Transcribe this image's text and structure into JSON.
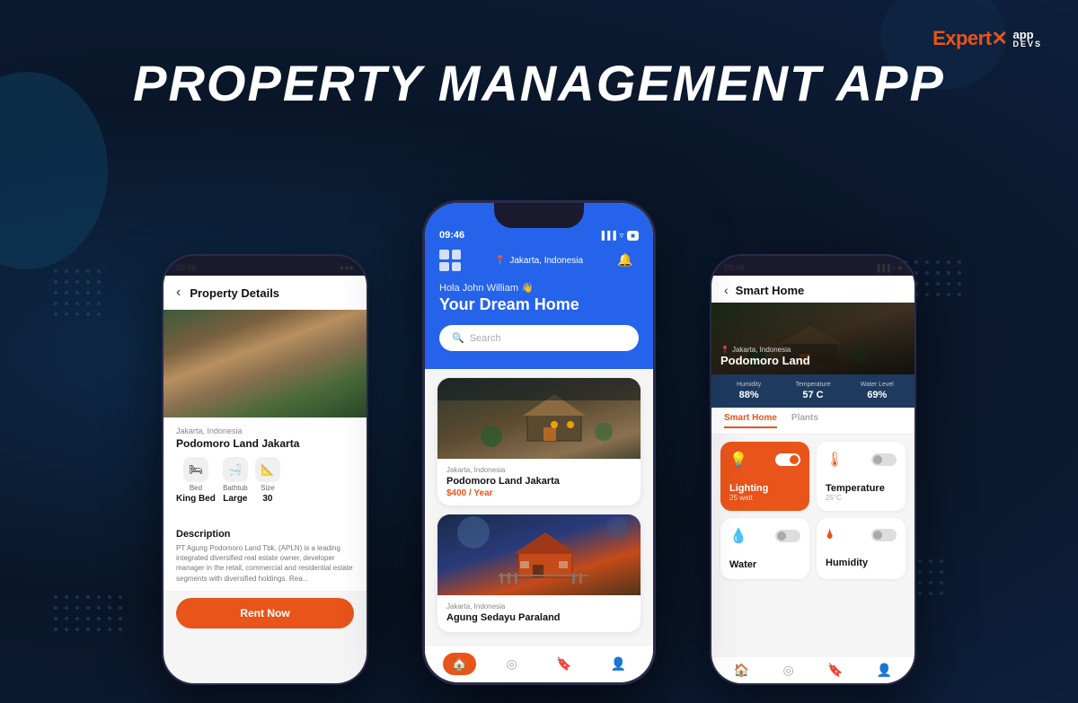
{
  "app": {
    "title": "PROPERTY MANAGEMENT APP",
    "logo": {
      "expert": "Expert",
      "app": "app",
      "devs": "DEVS"
    }
  },
  "left_phone": {
    "status_time": "09:46",
    "header_title": "Property Details",
    "back": "‹",
    "location": "Jakarta, Indonesia",
    "property_name": "Podomoro Land Jakarta",
    "amenities": [
      {
        "icon": "🛏",
        "label": "Bed",
        "value": "King Bed"
      },
      {
        "icon": "🛁",
        "label": "Bathtub",
        "value": "Large"
      },
      {
        "icon": "📐",
        "label": "Size",
        "value": "30"
      }
    ],
    "description_title": "Description",
    "description_text": "PT Agung Podomoro Land Tbk. (APLN) is a leading integrated diversified real estate owner, developer manager in the retail, commercial and residential estate segments with diversified holdings. Rea...",
    "rent_button": "Rent Now"
  },
  "center_phone": {
    "status_time": "09:46",
    "location": "Jakarta, Indonesia",
    "greeting": "Hola John William 👋",
    "dream_home": "Your Dream Home",
    "search_placeholder": "Search",
    "properties": [
      {
        "location": "Jakarta, Indonesia",
        "name": "Podomoro Land Jakarta",
        "price": "$400 / Year"
      },
      {
        "location": "Jakarta, Indonesia",
        "name": "Agung Sedayu Paraland",
        "price": ""
      }
    ],
    "nav": [
      "🏠",
      "◎",
      "🔖",
      "👤"
    ]
  },
  "right_phone": {
    "status_time": "09:46",
    "header_title": "Smart Home",
    "back": "‹",
    "property_location": "Jakarta, Indonesia",
    "property_name": "Podomoro Land",
    "stats": [
      {
        "label": "Humidity",
        "value": "88%"
      },
      {
        "label": "Temperature",
        "value": "57 C"
      },
      {
        "label": "Water Level",
        "value": "69%"
      }
    ],
    "tabs": [
      "Smart Home",
      "Plants"
    ],
    "active_tab": "Smart Home",
    "controls": [
      {
        "icon": "💡",
        "name": "Lighting",
        "sub": "25 watt",
        "active": true,
        "toggle_on": true
      },
      {
        "icon": "🌡",
        "name": "Temperature",
        "sub": "25°C",
        "active": false,
        "toggle_on": false
      },
      {
        "icon": "💧",
        "name": "Water",
        "sub": "",
        "active": false,
        "toggle_on": false
      },
      {
        "icon": "💧",
        "name": "Humidity",
        "sub": "",
        "active": false,
        "toggle_on": false
      }
    ]
  }
}
